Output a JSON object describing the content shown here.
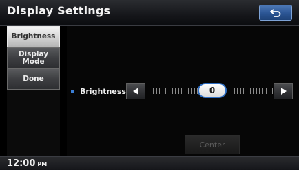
{
  "header": {
    "title": "Display Settings",
    "back_icon": "return-arrow-icon"
  },
  "sidebar": {
    "items": [
      {
        "label": "Brightness",
        "selected": true
      },
      {
        "label_line1": "Display",
        "label_line2": "Mode",
        "selected": false
      },
      {
        "label": "Done",
        "selected": false
      }
    ]
  },
  "main": {
    "brightness_label": "Brightness",
    "brightness_value": "0",
    "decrease_icon": "left-arrow-icon",
    "increase_icon": "right-arrow-icon",
    "center_label": "Center"
  },
  "status": {
    "time": "12:00",
    "ampm": "PM"
  },
  "colors": {
    "accent": "#2f6fc4",
    "bullet": "#3b7fd6"
  }
}
